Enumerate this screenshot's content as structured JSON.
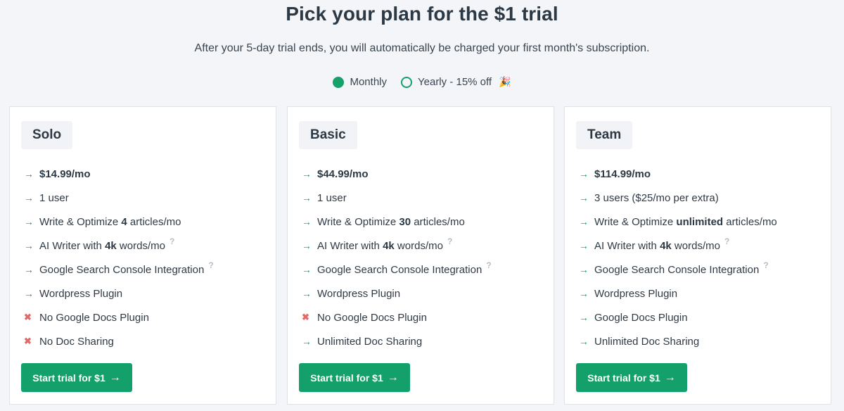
{
  "header": {
    "title": "Pick your plan for the $1 trial",
    "subtitle": "After your 5-day trial ends, you will automatically be charged your first month's subscription."
  },
  "billing_toggle": {
    "options": [
      {
        "label": "Monthly",
        "selected": true
      },
      {
        "label": "Yearly - 15% off",
        "selected": false,
        "emoji": "🎉"
      }
    ]
  },
  "colors": {
    "accent": "#16a06a",
    "cross": "#e06a6a",
    "card_bg": "#ffffff",
    "page_bg": "#f3f5f8"
  },
  "plans": [
    {
      "name": "Solo",
      "features": [
        {
          "icon": "arrow-right-icon",
          "pre": "",
          "bold": "$14.99/mo",
          "post": "",
          "help": false
        },
        {
          "icon": "arrow-right-icon",
          "pre": "1 user",
          "bold": "",
          "post": "",
          "help": false
        },
        {
          "icon": "arrow-right-icon",
          "pre": "Write & Optimize ",
          "bold": "4",
          "post": " articles/mo",
          "help": false
        },
        {
          "icon": "arrow-right-icon",
          "pre": "AI Writer with ",
          "bold": "4k",
          "post": " words/mo",
          "help": true
        },
        {
          "icon": "arrow-right-icon",
          "pre": "Google Search Console Integration",
          "bold": "",
          "post": "",
          "help": true
        },
        {
          "icon": "arrow-right-icon",
          "pre": "Wordpress Plugin",
          "bold": "",
          "post": "",
          "help": false
        },
        {
          "icon": "cross-icon",
          "pre": "No Google Docs Plugin",
          "bold": "",
          "post": "",
          "help": false
        },
        {
          "icon": "cross-icon",
          "pre": "No Doc Sharing",
          "bold": "",
          "post": "",
          "help": false
        }
      ],
      "button": "Start trial for $1"
    },
    {
      "name": "Basic",
      "features": [
        {
          "icon": "arrow-right-icon",
          "pre": "",
          "bold": "$44.99/mo",
          "post": "",
          "help": false
        },
        {
          "icon": "arrow-right-icon",
          "pre": "1 user",
          "bold": "",
          "post": "",
          "help": false
        },
        {
          "icon": "arrow-right-icon",
          "pre": "Write & Optimize ",
          "bold": "30",
          "post": " articles/mo",
          "help": false
        },
        {
          "icon": "arrow-right-icon",
          "pre": "AI Writer with ",
          "bold": "4k",
          "post": " words/mo",
          "help": true
        },
        {
          "icon": "arrow-right-icon",
          "pre": "Google Search Console Integration",
          "bold": "",
          "post": "",
          "help": true
        },
        {
          "icon": "arrow-right-icon",
          "pre": "Wordpress Plugin",
          "bold": "",
          "post": "",
          "help": false
        },
        {
          "icon": "cross-icon",
          "pre": "No Google Docs Plugin",
          "bold": "",
          "post": "",
          "help": false
        },
        {
          "icon": "arrow-right-icon",
          "pre": "Unlimited Doc Sharing",
          "bold": "",
          "post": "",
          "help": false
        }
      ],
      "button": "Start trial for $1"
    },
    {
      "name": "Team",
      "features": [
        {
          "icon": "arrow-right-icon",
          "pre": "",
          "bold": "$114.99/mo",
          "post": "",
          "help": false
        },
        {
          "icon": "arrow-right-icon",
          "pre": "3 users ($25/mo per extra)",
          "bold": "",
          "post": "",
          "help": false
        },
        {
          "icon": "arrow-right-icon",
          "pre": "Write & Optimize ",
          "bold": "unlimited",
          "post": " articles/mo",
          "help": false
        },
        {
          "icon": "arrow-right-icon",
          "pre": "AI Writer with ",
          "bold": "4k",
          "post": " words/mo",
          "help": true
        },
        {
          "icon": "arrow-right-icon",
          "pre": "Google Search Console Integration",
          "bold": "",
          "post": "",
          "help": true
        },
        {
          "icon": "arrow-right-icon",
          "pre": "Wordpress Plugin",
          "bold": "",
          "post": "",
          "help": false
        },
        {
          "icon": "arrow-right-icon",
          "pre": "Google Docs Plugin",
          "bold": "",
          "post": "",
          "help": false
        },
        {
          "icon": "arrow-right-icon",
          "pre": "Unlimited Doc Sharing",
          "bold": "",
          "post": "",
          "help": false
        }
      ],
      "button": "Start trial for $1"
    }
  ]
}
